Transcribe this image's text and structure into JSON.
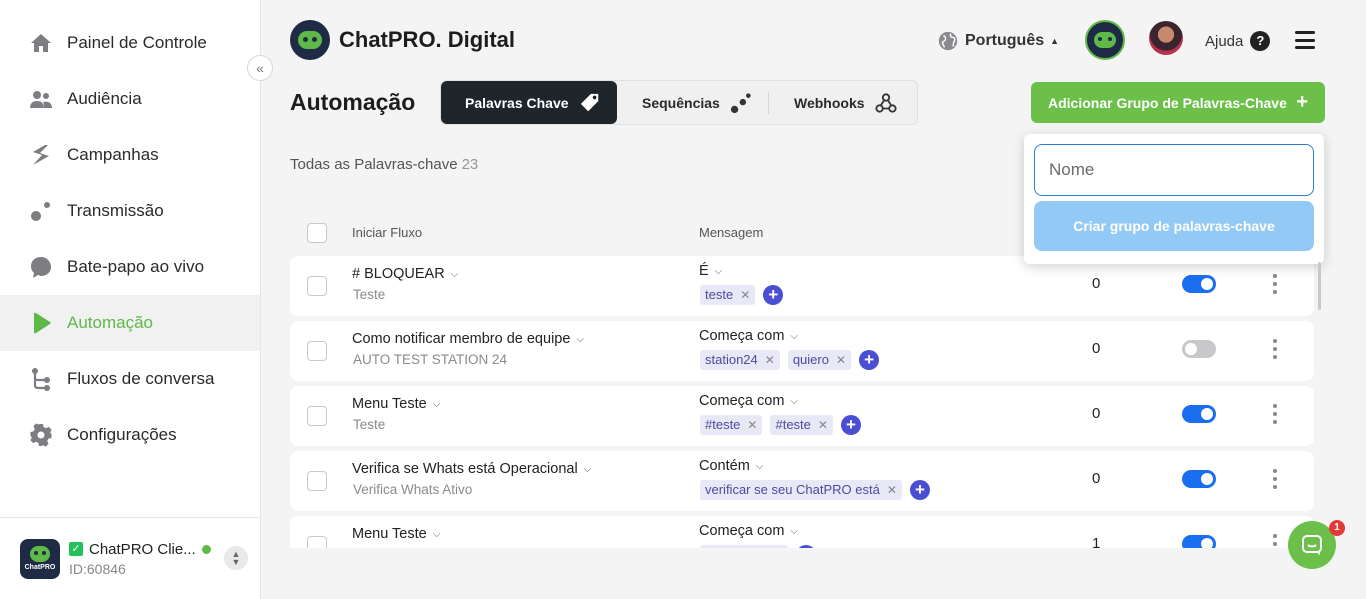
{
  "sidebar": {
    "items": [
      {
        "label": "Painel de Controle",
        "icon": "home-icon"
      },
      {
        "label": "Audiência",
        "icon": "users-icon"
      },
      {
        "label": "Campanhas",
        "icon": "campaign-icon"
      },
      {
        "label": "Transmissão",
        "icon": "broadcast-icon"
      },
      {
        "label": "Bate-papo ao vivo",
        "icon": "chat-icon"
      },
      {
        "label": "Automação",
        "icon": "play-icon"
      },
      {
        "label": "Fluxos de conversa",
        "icon": "flow-icon"
      },
      {
        "label": "Configurações",
        "icon": "gear-icon"
      }
    ],
    "active": "Automação",
    "collapse_glyph": "«",
    "account": {
      "name": "ChatPRO Clie...",
      "id": "ID:60846",
      "logo_text": "ChatPRO"
    }
  },
  "header": {
    "brand": "ChatPRO. Digital",
    "language": "Português",
    "help": "Ajuda",
    "help_glyph": "?"
  },
  "page": {
    "title": "Automação",
    "tabs": [
      {
        "label": "Palavras Chave",
        "icon": "tag-icon",
        "active": true
      },
      {
        "label": "Sequências",
        "icon": "sequence-icon",
        "active": false
      },
      {
        "label": "Webhooks",
        "icon": "webhook-icon",
        "active": false
      }
    ],
    "add_button": "Adicionar Grupo de Palavras-Chave",
    "add_glyph": "+",
    "count_label": "Todas as Palavras-chave",
    "count": "23"
  },
  "table": {
    "headers": {
      "flow": "Iniciar Fluxo",
      "message": "Mensagem"
    },
    "rows": [
      {
        "title": "# BLOQUEAR",
        "sub": "Teste",
        "match": "É",
        "tags": [
          "teste"
        ],
        "count": "0",
        "enabled": true
      },
      {
        "title": "Como notificar membro de equipe",
        "sub": "AUTO TEST STATION 24",
        "match": "Começa com",
        "tags": [
          "station24",
          "quiero"
        ],
        "count": "0",
        "enabled": false
      },
      {
        "title": "Menu Teste",
        "sub": "Teste",
        "match": "Começa com",
        "tags": [
          "#teste",
          "#teste"
        ],
        "count": "0",
        "enabled": true
      },
      {
        "title": "Verifica se Whats está Operacional",
        "sub": "Verifica Whats Ativo",
        "match": "Contém",
        "tags": [
          "verificar se seu ChatPRO está"
        ],
        "count": "0",
        "enabled": true
      },
      {
        "title": "Menu Teste",
        "sub": "",
        "match": "Começa com",
        "tags": [],
        "count": "1",
        "enabled": true
      }
    ]
  },
  "popup": {
    "placeholder": "Nome",
    "button": "Criar grupo de palavras-chave"
  },
  "chat_widget": {
    "badge": "1"
  },
  "colors": {
    "accent_green": "#6cc04a",
    "toggle_blue": "#1a6ef0",
    "tag_purple": "#4a4ed3"
  }
}
